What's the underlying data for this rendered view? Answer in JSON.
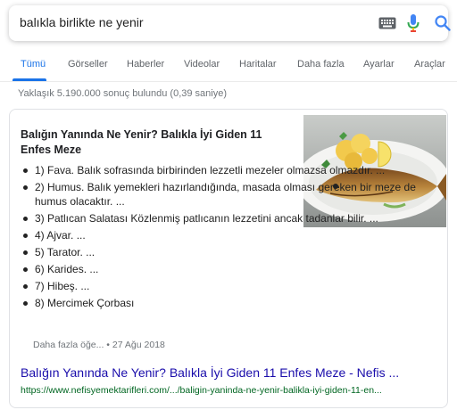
{
  "search": {
    "query": "balıkla birlikte ne yenir",
    "icons": [
      "keyboard-icon",
      "microphone-icon",
      "search-icon"
    ]
  },
  "tabs": [
    {
      "label": "Tümü",
      "active": true
    },
    {
      "label": "Görseller"
    },
    {
      "label": "Haberler"
    },
    {
      "label": "Videolar"
    },
    {
      "label": "Haritalar"
    },
    {
      "label": "Daha fazla"
    },
    {
      "label": "Ayarlar"
    },
    {
      "label": "Araçlar"
    }
  ],
  "result_stats": "Yaklaşık 5.190.000 sonuç bulundu (0,39 saniye)",
  "snippet": {
    "title": "Balığın Yanında Ne Yenir? Balıkla İyi Giden 11 Enfes Meze",
    "items": [
      "1) Fava. Balık sofrasında birbirinden lezzetli mezeler olmazsa olmazdır. ...",
      "2) Humus. Balık yemekleri hazırlandığında, masada olması gereken bir meze de humus olacaktır. ...",
      "3) Patlıcan Salatası Közlenmiş patlıcanın lezzetini ancak tadanlar bilir. ...",
      "4) Ajvar. ...",
      "5) Tarator. ...",
      "6) Karides. ...",
      "7) Hibeş. ...",
      "8) Mercimek Çorbası"
    ],
    "more_label": "Daha fazla öğe...",
    "separator": " • ",
    "date": "27 Ağu 2018",
    "link_title": "Balığın Yanında Ne Yenir? Balıkla İyi Giden 11 Enfes Meze - Nefis ...",
    "url": "https://www.nefisyemektarifleri.com/.../baligin-yaninda-ne-yenir-balikla-iyi-giden-11-en..."
  },
  "colors": {
    "link": "#1a0dab",
    "url": "#006621",
    "active_tab": "#1a73e8",
    "muted": "#70757a"
  }
}
